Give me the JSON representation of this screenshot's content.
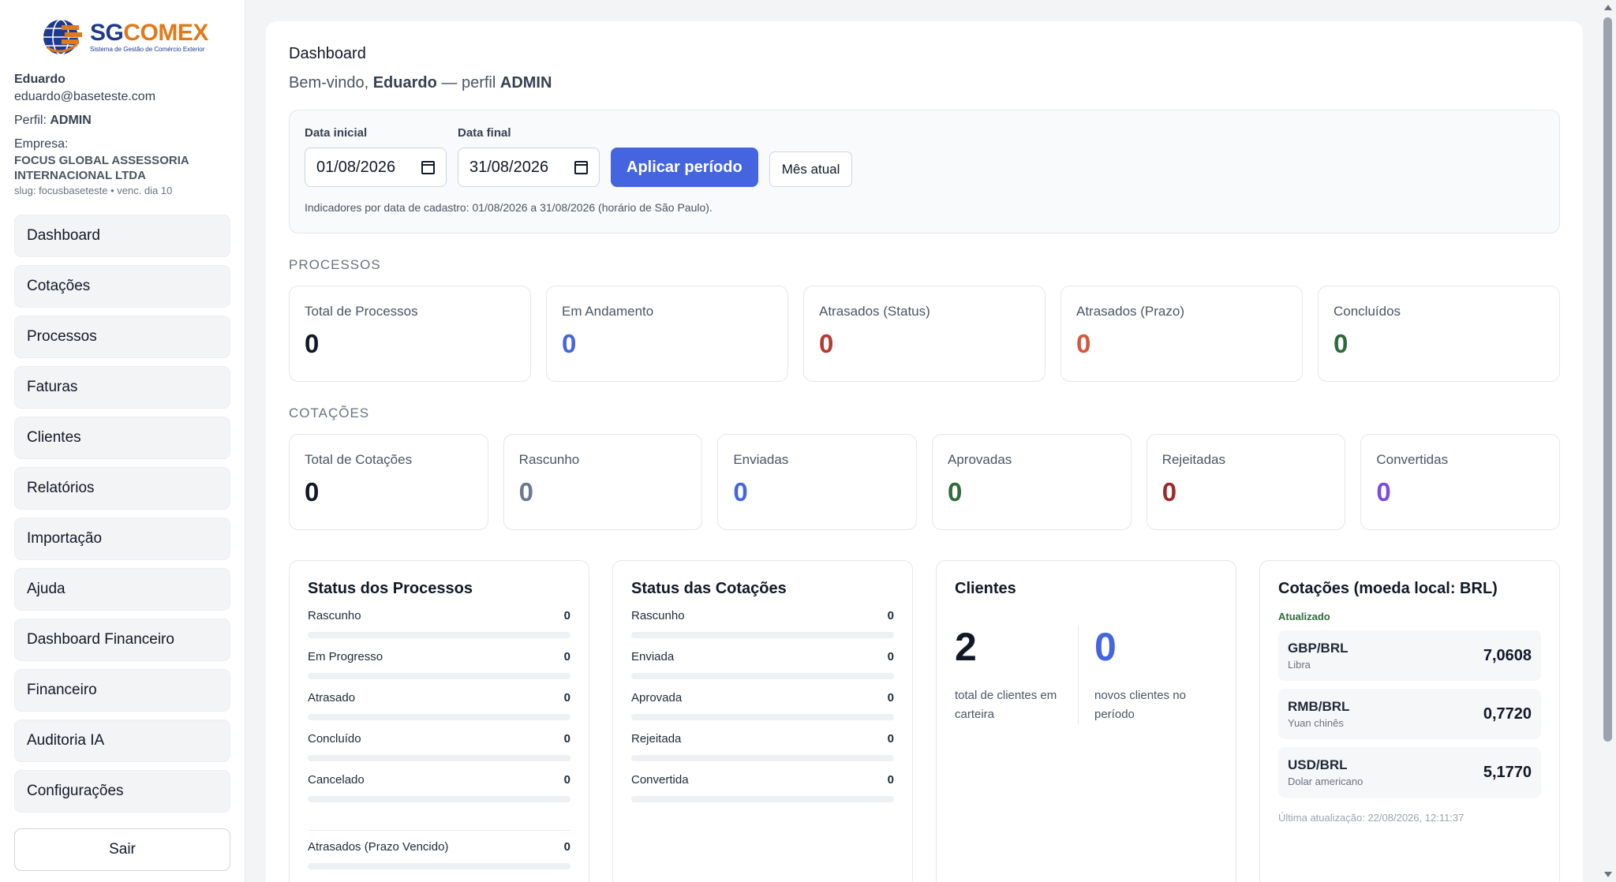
{
  "brand": {
    "name_part1": "SG",
    "name_part2": "COMEX",
    "tagline": "Sistema de Gestão de Comércio Exterior"
  },
  "user": {
    "name": "Eduardo",
    "email": "eduardo@baseteste.com",
    "profile_label": "Perfil:",
    "profile": "ADMIN",
    "company_label": "Empresa:",
    "company_line1": "FOCUS GLOBAL ASSESSORIA",
    "company_line2": "INTERNACIONAL LTDA",
    "slug": "slug: focusbaseteste • venc. dia 10"
  },
  "nav": {
    "items": [
      {
        "label": "Dashboard"
      },
      {
        "label": "Cotações"
      },
      {
        "label": "Processos"
      },
      {
        "label": "Faturas"
      },
      {
        "label": "Clientes"
      },
      {
        "label": "Relatórios"
      },
      {
        "label": "Importação"
      },
      {
        "label": "Ajuda"
      },
      {
        "label": "Dashboard Financeiro"
      },
      {
        "label": "Financeiro"
      },
      {
        "label": "Auditoria IA"
      },
      {
        "label": "Configurações"
      }
    ],
    "logout": "Sair"
  },
  "header": {
    "title": "Dashboard",
    "welcome_prefix": "Bem-vindo,",
    "welcome_name": "Eduardo",
    "welcome_mid": "— perfil",
    "welcome_profile": "ADMIN"
  },
  "filter": {
    "start_label": "Data inicial",
    "start_value": "01/08/2026",
    "end_label": "Data final",
    "end_value": "31/08/2026",
    "apply": "Aplicar período",
    "current_month": "Mês atual",
    "note": "Indicadores por data de cadastro: 01/08/2026 a 31/08/2026 (horário de São Paulo)."
  },
  "processos": {
    "section": "PROCESSOS",
    "cards": [
      {
        "label": "Total de Processos",
        "value": "0",
        "color": "#111827"
      },
      {
        "label": "Em Andamento",
        "value": "0",
        "color": "#4565e0"
      },
      {
        "label": "Atrasados (Status)",
        "value": "0",
        "color": "#b53a33"
      },
      {
        "label": "Atrasados (Prazo)",
        "value": "0",
        "color": "#d4573f"
      },
      {
        "label": "Concluídos",
        "value": "0",
        "color": "#2f6b3a"
      }
    ]
  },
  "cotacoes": {
    "section": "COTAÇÕES",
    "cards": [
      {
        "label": "Total de Cotações",
        "value": "0",
        "color": "#111827"
      },
      {
        "label": "Rascunho",
        "value": "0",
        "color": "#6b7a90"
      },
      {
        "label": "Enviadas",
        "value": "0",
        "color": "#4565e0"
      },
      {
        "label": "Aprovadas",
        "value": "0",
        "color": "#2f6b3a"
      },
      {
        "label": "Rejeitadas",
        "value": "0",
        "color": "#9b2b2b"
      },
      {
        "label": "Convertidas",
        "value": "0",
        "color": "#7c4be0"
      }
    ]
  },
  "status_processos": {
    "title": "Status dos Processos",
    "items": [
      {
        "label": "Rascunho",
        "value": "0",
        "fraction": 0
      },
      {
        "label": "Em Progresso",
        "value": "0",
        "fraction": 0
      },
      {
        "label": "Atrasado",
        "value": "0",
        "fraction": 0
      },
      {
        "label": "Concluído",
        "value": "0",
        "fraction": 0
      },
      {
        "label": "Cancelado",
        "value": "0",
        "fraction": 0
      }
    ],
    "overdue": {
      "label": "Atrasados (Prazo Vencido)",
      "value": "0",
      "fraction": 0
    }
  },
  "status_cotacoes": {
    "title": "Status das Cotações",
    "items": [
      {
        "label": "Rascunho",
        "value": "0",
        "fraction": 0
      },
      {
        "label": "Enviada",
        "value": "0",
        "fraction": 0
      },
      {
        "label": "Aprovada",
        "value": "0",
        "fraction": 0
      },
      {
        "label": "Rejeitada",
        "value": "0",
        "fraction": 0
      },
      {
        "label": "Convertida",
        "value": "0",
        "fraction": 0
      }
    ]
  },
  "clientes": {
    "title": "Clientes",
    "total": "2",
    "total_desc": "total de clientes em carteira",
    "new": "0",
    "new_desc": "novos clientes no período"
  },
  "rates": {
    "title": "Cotações (moeda local: BRL)",
    "updated": "Atualizado",
    "items": [
      {
        "pair": "GBP/BRL",
        "name": "Libra",
        "value": "7,0608"
      },
      {
        "pair": "RMB/BRL",
        "name": "Yuan chinês",
        "value": "0,7720"
      },
      {
        "pair": "USD/BRL",
        "name": "Dolar americano",
        "value": "5,1770"
      }
    ],
    "footer": "Última atualização: 22/08/2026, 12:11:37"
  }
}
